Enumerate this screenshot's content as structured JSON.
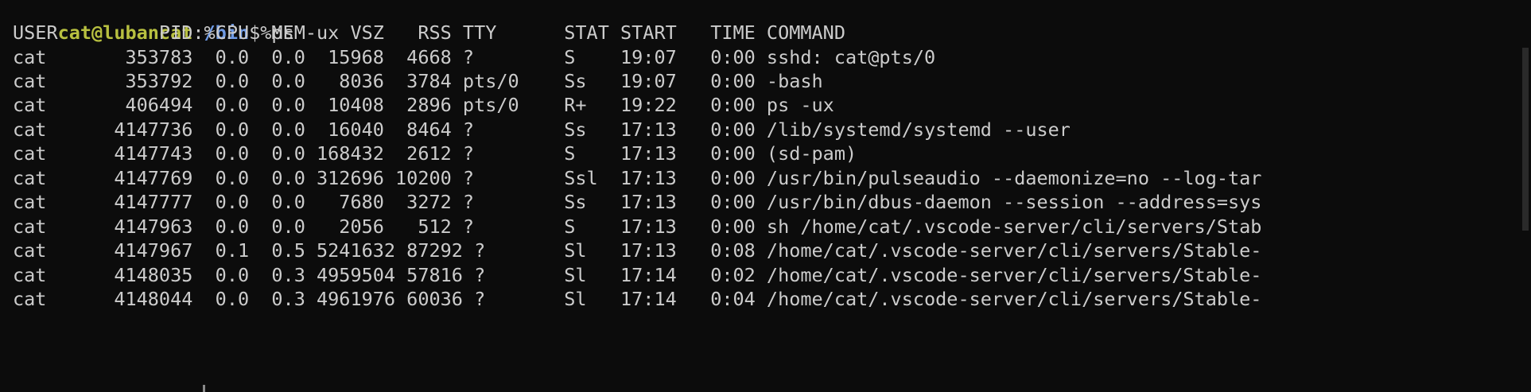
{
  "prompt": {
    "user_host": "cat@lubancat",
    "colon": ":",
    "path": "/bin",
    "dollar": "$",
    "command": " ps -ux"
  },
  "table": {
    "header": "USER         PID %CPU %MEM    VSZ   RSS TTY      STAT START   TIME COMMAND",
    "rows": [
      "cat       353783  0.0  0.0  15968  4668 ?        S    19:07   0:00 sshd: cat@pts/0",
      "cat       353792  0.0  0.0   8036  3784 pts/0    Ss   19:07   0:00 -bash",
      "cat       406494  0.0  0.0  10408  2896 pts/0    R+   19:22   0:00 ps -ux",
      "cat      4147736  0.0  0.0  16040  8464 ?        Ss   17:13   0:00 /lib/systemd/systemd --user",
      "cat      4147743  0.0  0.0 168432  2612 ?        S    17:13   0:00 (sd-pam)",
      "cat      4147769  0.0  0.0 312696 10200 ?        Ssl  17:13   0:00 /usr/bin/pulseaudio --daemonize=no --log-tar",
      "cat      4147777  0.0  0.0   7680  3272 ?        Ss   17:13   0:00 /usr/bin/dbus-daemon --session --address=sys",
      "cat      4147963  0.0  0.0   2056   512 ?        S    17:13   0:00 sh /home/cat/.vscode-server/cli/servers/Stab",
      "cat      4147967  0.1  0.5 5241632 87292 ?       Sl   17:13   0:08 /home/cat/.vscode-server/cli/servers/Stable-",
      "cat      4148035  0.0  0.3 4959504 57816 ?       Sl   17:14   0:02 /home/cat/.vscode-server/cli/servers/Stable-",
      "cat      4148044  0.0  0.3 4961976 60036 ?       Sl   17:14   0:04 /home/cat/.vscode-server/cli/servers/Stable-"
    ]
  },
  "colors": {
    "background": "#0c0c0c",
    "text": "#cccccc",
    "prompt_user": "#b8c040",
    "prompt_path": "#6f9be6"
  }
}
